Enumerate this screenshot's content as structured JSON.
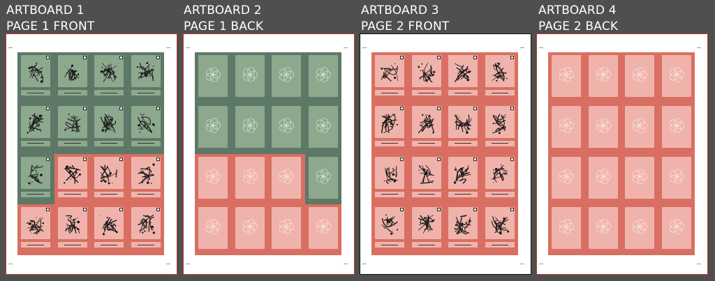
{
  "artboards": [
    {
      "line1": "ARTBOARD 1",
      "line2": "PAGE 1 FRONT",
      "type": "front",
      "layout": [
        [
          "green",
          "green",
          "green",
          "green"
        ],
        [
          "green",
          "green",
          "green",
          "green"
        ],
        [
          "green",
          "red",
          "red",
          "red"
        ],
        [
          "red",
          "red",
          "red",
          "red"
        ]
      ],
      "selected": false
    },
    {
      "line1": "ARTBOARD 2",
      "line2": "PAGE 1 BACK",
      "type": "back",
      "layout": [
        [
          "green",
          "green",
          "green",
          "green"
        ],
        [
          "green",
          "green",
          "green",
          "green"
        ],
        [
          "red",
          "red",
          "red",
          "green"
        ],
        [
          "red",
          "red",
          "red",
          "red"
        ]
      ],
      "selected": false
    },
    {
      "line1": "ARTBOARD 3",
      "line2": "PAGE 2 FRONT",
      "type": "front",
      "layout": [
        [
          "red",
          "red",
          "red",
          "red"
        ],
        [
          "red",
          "red",
          "red",
          "red"
        ],
        [
          "red",
          "red",
          "red",
          "red"
        ],
        [
          "red",
          "red",
          "red",
          "red"
        ]
      ],
      "selected": true
    },
    {
      "line1": "ARTBOARD 4",
      "line2": "PAGE 2 BACK",
      "type": "back",
      "layout": [
        [
          "red",
          "red",
          "red",
          "red"
        ],
        [
          "red",
          "red",
          "red",
          "red"
        ],
        [
          "red",
          "red",
          "red",
          "red"
        ],
        [
          "red",
          "red",
          "red",
          "red"
        ]
      ],
      "selected": false
    }
  ],
  "colors": {
    "workspace": "#4f4f4f",
    "green_bleed": "#5d7866",
    "green_card": "#8ea88e",
    "red_bleed": "#d96f62",
    "red_card": "#f0b3ab",
    "artboard_border": "#c0392b"
  }
}
